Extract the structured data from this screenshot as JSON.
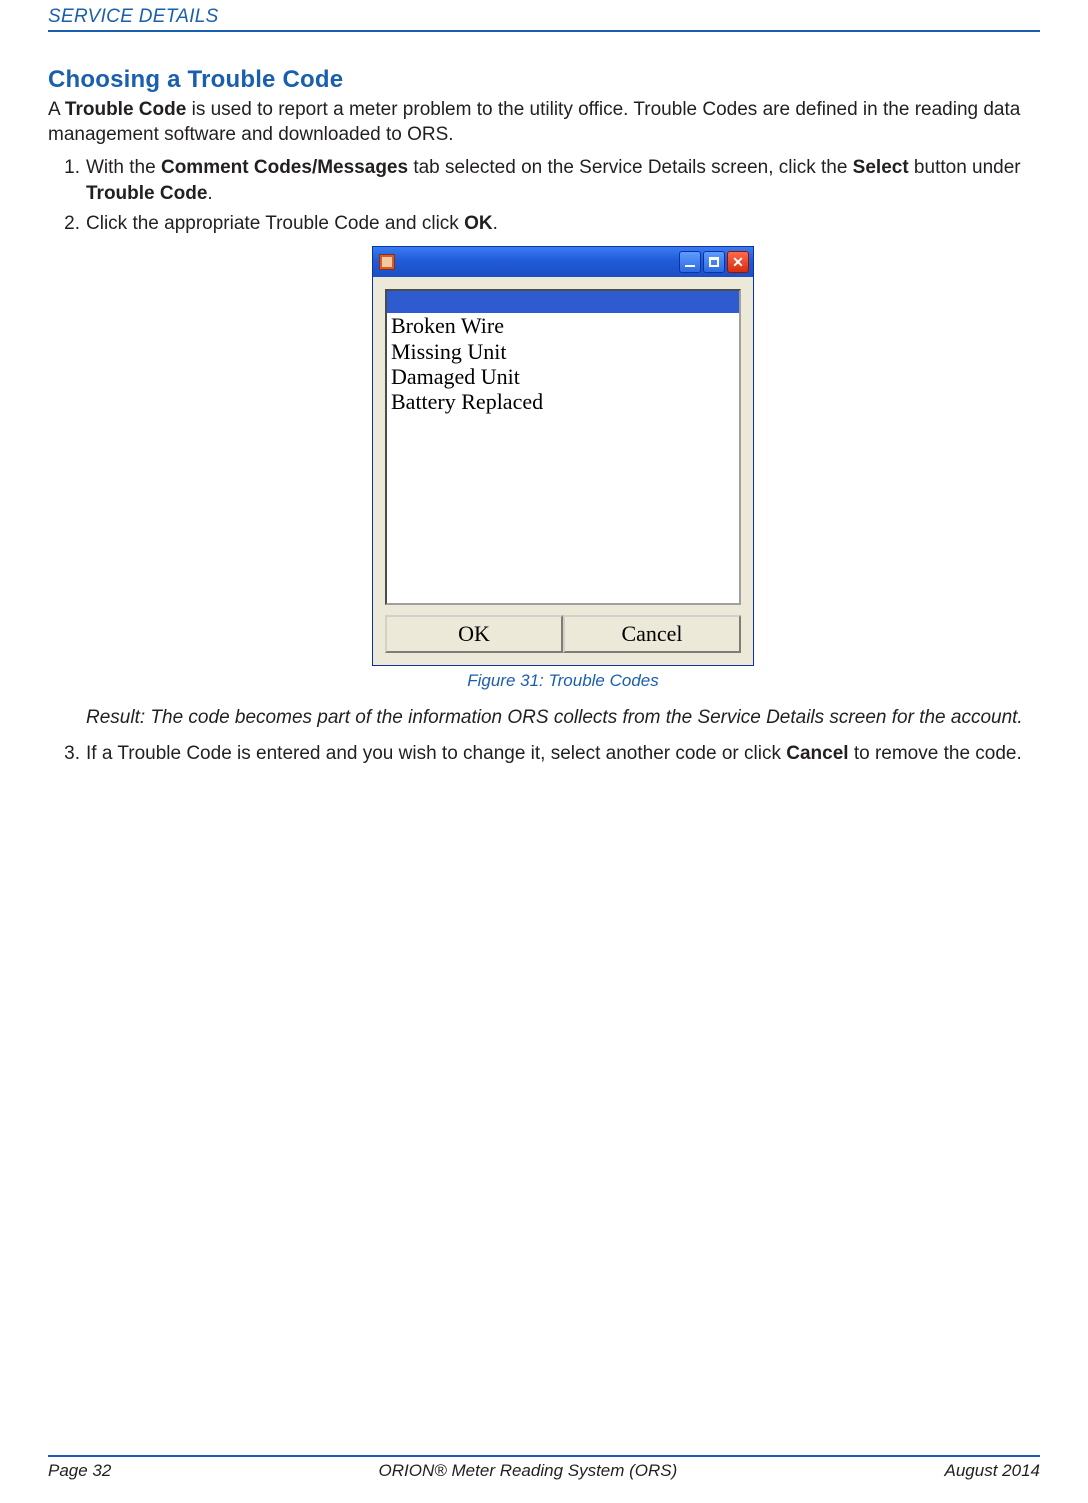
{
  "header": {
    "section": "SERVICE DETAILS"
  },
  "title": "Choosing a Trouble Code",
  "intro": {
    "pre": "A ",
    "bold": "Trouble Code",
    "post": " is used to report a meter problem to the utility office. Trouble Codes are defined in the reading data management software and downloaded to ORS."
  },
  "steps": {
    "s1": {
      "a": "With the ",
      "b": "Comment Codes/Messages",
      "c": " tab selected on the Service Details screen, click the ",
      "d": "Select",
      "e": " button under ",
      "f": "Trouble Code",
      "g": "."
    },
    "s2": {
      "a": "Click the appropriate Trouble Code and click ",
      "b": "OK",
      "c": "."
    },
    "s3": {
      "a": "If a Trouble Code is entered and you wish to change it, select another code or click ",
      "b": "Cancel",
      "c": " to remove the code."
    }
  },
  "dialog": {
    "items": [
      "Broken Wire",
      "Missing Unit",
      "Damaged Unit",
      "Battery Replaced"
    ],
    "ok": "OK",
    "cancel": "Cancel"
  },
  "figure_caption": "Figure 31:  Trouble Codes",
  "result": "Result: The code becomes part of the information ORS collects from the Service Details screen for the account.",
  "footer": {
    "left": "Page 32",
    "center": "ORION® Meter Reading System (ORS)",
    "right": "August  2014"
  }
}
